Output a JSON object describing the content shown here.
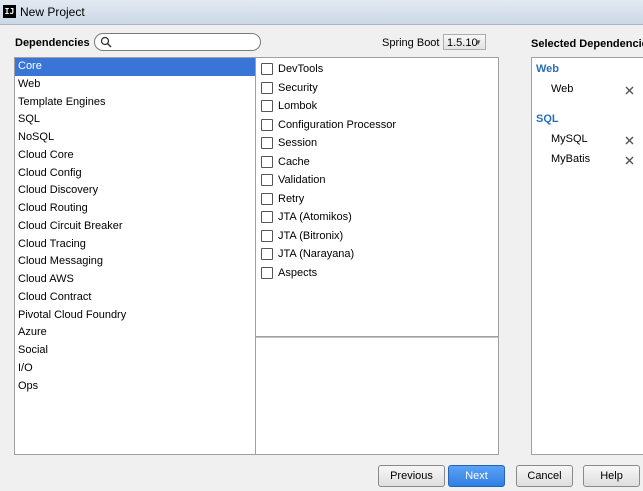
{
  "window": {
    "icon_text": "IJ",
    "title": "New Project"
  },
  "header": {
    "dependencies_label": "Dependencies",
    "search": {
      "value": "",
      "placeholder": ""
    },
    "spring_boot_label": "Spring Boot",
    "spring_boot_version": "1.5.10"
  },
  "categories": [
    "Core",
    "Web",
    "Template Engines",
    "SQL",
    "NoSQL",
    "Cloud Core",
    "Cloud Config",
    "Cloud Discovery",
    "Cloud Routing",
    "Cloud Circuit Breaker",
    "Cloud Tracing",
    "Cloud Messaging",
    "Cloud AWS",
    "Cloud Contract",
    "Pivotal Cloud Foundry",
    "Azure",
    "Social",
    "I/O",
    "Ops"
  ],
  "selected_category": "Core",
  "dependencies": [
    "DevTools",
    "Security",
    "Lombok",
    "Configuration Processor",
    "Session",
    "Cache",
    "Validation",
    "Retry",
    "JTA (Atomikos)",
    "JTA (Bitronix)",
    "JTA (Narayana)",
    "Aspects"
  ],
  "selected_panel": {
    "title": "Selected Dependencies",
    "groups": [
      {
        "name": "Web",
        "items": [
          "Web"
        ]
      },
      {
        "name": "SQL",
        "items": [
          "MySQL",
          "MyBatis"
        ]
      }
    ]
  },
  "buttons": {
    "previous": "Previous",
    "next": "Next",
    "cancel": "Cancel",
    "help": "Help"
  },
  "colors": {
    "selection": "#3875d7",
    "primary_button": "#2f7fe3",
    "group_title": "#2a6fb8"
  }
}
